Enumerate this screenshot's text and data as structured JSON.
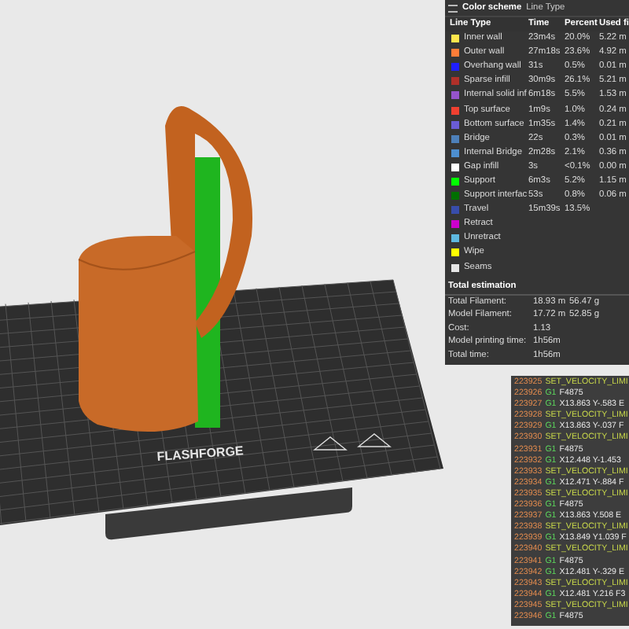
{
  "viewport": {
    "bed_logo": "FLASHFORGE"
  },
  "legend": {
    "title": "Color scheme",
    "scheme": "Line Type",
    "columns": [
      "Line Type",
      "Time",
      "Percent",
      "Used fi"
    ],
    "rows": [
      {
        "name": "Inner wall",
        "color": "#ffe64d",
        "time": "23m4s",
        "percent": "20.0%",
        "used": "5.22 m"
      },
      {
        "name": "Outer wall",
        "color": "#ff7d38",
        "time": "27m18s",
        "percent": "23.6%",
        "used": "4.92 m"
      },
      {
        "name": "Overhang wall",
        "color": "#1f1fff",
        "time": "31s",
        "percent": "0.5%",
        "used": "0.01 m"
      },
      {
        "name": "Sparse infill",
        "color": "#b03029",
        "time": "30m9s",
        "percent": "26.1%",
        "used": "5.21 m"
      },
      {
        "name": "Internal solid inf",
        "color": "#9654cc",
        "time": "6m18s",
        "percent": "5.5%",
        "used": "1.53 m"
      },
      {
        "name": "Top surface",
        "color": "#f04030",
        "time": "1m9s",
        "percent": "1.0%",
        "used": "0.24 m"
      },
      {
        "name": "Bottom surface",
        "color": "#6a5cd6",
        "time": "1m35s",
        "percent": "1.4%",
        "used": "0.21 m"
      },
      {
        "name": "Bridge",
        "color": "#4d80ba",
        "time": "22s",
        "percent": "0.3%",
        "used": "0.01 m"
      },
      {
        "name": "Internal Bridge",
        "color": "#4d8fd0",
        "time": "2m28s",
        "percent": "2.1%",
        "used": "0.36 m"
      },
      {
        "name": "Gap infill",
        "color": "#ffffff",
        "time": "3s",
        "percent": "<0.1%",
        "used": "0.00 m"
      },
      {
        "name": "Support",
        "color": "#00ff00",
        "time": "6m3s",
        "percent": "5.2%",
        "used": "1.15 m"
      },
      {
        "name": "Support interfac",
        "color": "#007000",
        "time": "53s",
        "percent": "0.8%",
        "used": "0.06 m"
      },
      {
        "name": "Travel",
        "color": "#384dab",
        "time": "15m39s",
        "percent": "13.5%"
      },
      {
        "name": "Retract",
        "color": "#cd00cd"
      },
      {
        "name": "Unretract",
        "color": "#5eb8e0"
      },
      {
        "name": "Wipe",
        "color": "#ffff00"
      },
      {
        "name": "Seams",
        "color": "#e6e6e6"
      }
    ],
    "total_title": "Total estimation",
    "totals": [
      {
        "label": "Total Filament:",
        "value": "18.93 m",
        "extra": "56.47 g"
      },
      {
        "label": "Model Filament:",
        "value": "17.72 m",
        "extra": "52.85 g"
      },
      {
        "label": "Cost:",
        "value": "1.13"
      },
      {
        "label": "Model printing time:",
        "value": "1h56m"
      },
      {
        "label": "Total time:",
        "value": "1h56m"
      }
    ]
  },
  "gcode": [
    {
      "line": "223925",
      "cmd": "SET_VELOCITY_LIMI"
    },
    {
      "line": "223926",
      "cmd": "G1",
      "args": "F4875"
    },
    {
      "line": "223927",
      "cmd": "G1",
      "args": "X13.863 Y-.583 E"
    },
    {
      "line": "223928",
      "cmd": "SET_VELOCITY_LIMI"
    },
    {
      "line": "223929",
      "cmd": "G1",
      "args": "X13.863 Y-.037 F"
    },
    {
      "line": "223930",
      "cmd": "SET_VELOCITY_LIMI"
    },
    {
      "line": "223931",
      "cmd": "G1",
      "args": "F4875"
    },
    {
      "line": "223932",
      "cmd": "G1",
      "args": "X12.448 Y-1.453"
    },
    {
      "line": "223933",
      "cmd": "SET_VELOCITY_LIMI"
    },
    {
      "line": "223934",
      "cmd": "G1",
      "args": "X12.471 Y-.884 F"
    },
    {
      "line": "223935",
      "cmd": "SET_VELOCITY_LIMI"
    },
    {
      "line": "223936",
      "cmd": "G1",
      "args": "F4875"
    },
    {
      "line": "223937",
      "cmd": "G1",
      "args": "X13.863 Y.508 E"
    },
    {
      "line": "223938",
      "cmd": "SET_VELOCITY_LIMI"
    },
    {
      "line": "223939",
      "cmd": "G1",
      "args": "X13.849 Y1.039 F"
    },
    {
      "line": "223940",
      "cmd": "SET_VELOCITY_LIMI"
    },
    {
      "line": "223941",
      "cmd": "G1",
      "args": "F4875"
    },
    {
      "line": "223942",
      "cmd": "G1",
      "args": "X12.481 Y-.329 E"
    },
    {
      "line": "223943",
      "cmd": "SET_VELOCITY_LIMI"
    },
    {
      "line": "223944",
      "cmd": "G1",
      "args": "X12.481 Y.216 F3"
    },
    {
      "line": "223945",
      "cmd": "SET_VELOCITY_LIMI"
    },
    {
      "line": "223946",
      "cmd": "G1",
      "args": "F4875"
    }
  ]
}
